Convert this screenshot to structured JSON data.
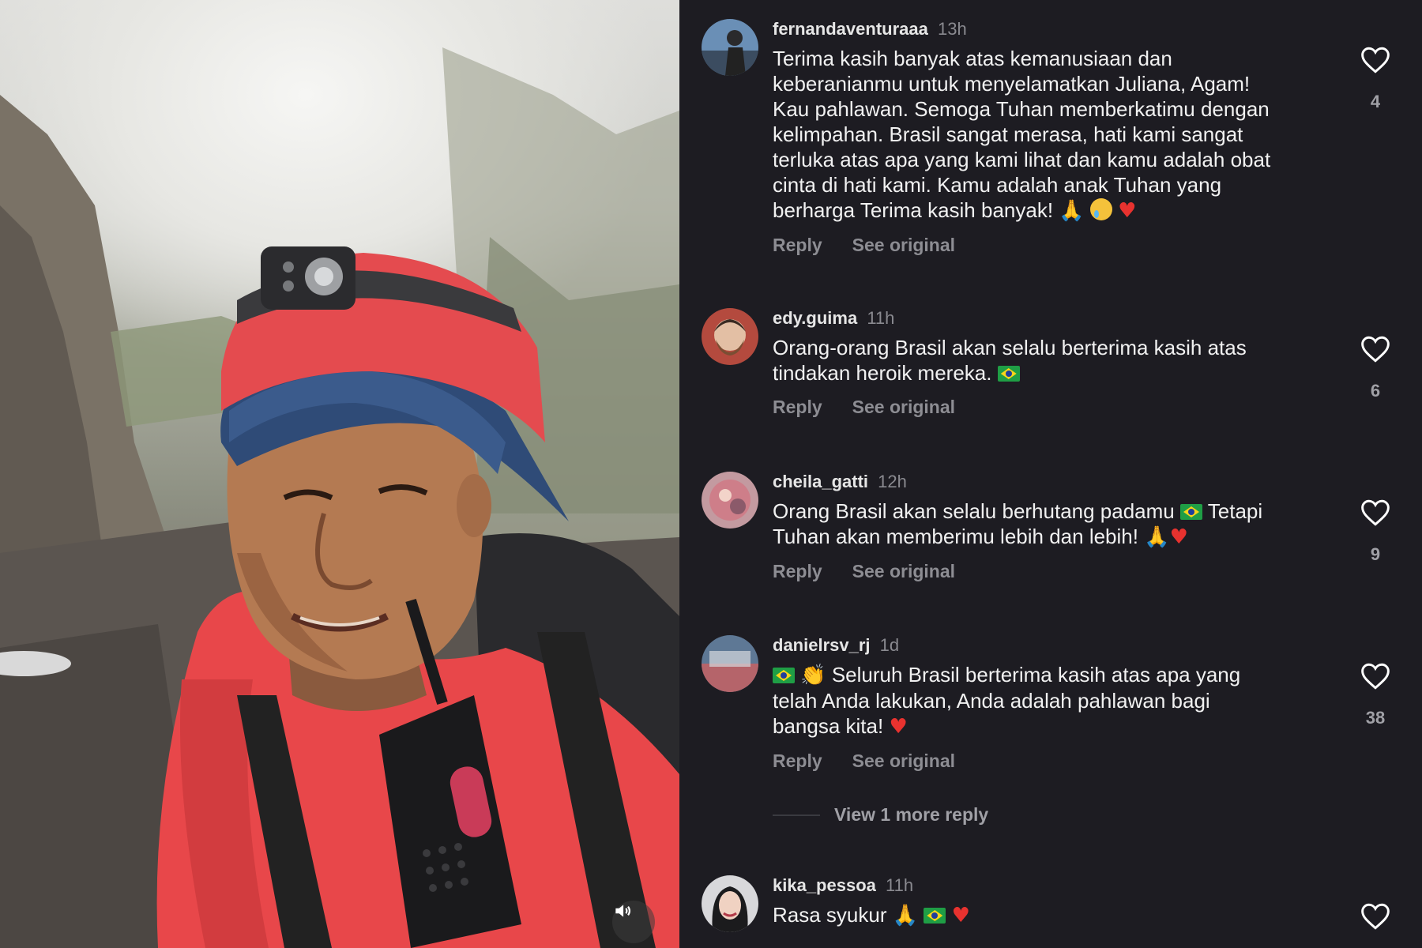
{
  "comments": [
    {
      "username": "fernandaventuraaa",
      "time": "13h",
      "text": "Terima kasih banyak atas kemanusiaan dan\nkeberanianmu untuk menyelamatkan Juliana, Agam!\nKau pahlawan. Semoga Tuhan memberkatimu dengan\nkelimpahan. Brasil sangat merasa, hati kami sangat\nterluka atas apa yang kami lihat dan kamu adalah obat\ncinta di hati kami. Kamu adalah anak Tuhan yang\nberharga Terima kasih banyak!",
      "likes": "4",
      "reply_label": "Reply",
      "see_original_label": "See original"
    },
    {
      "username": "edy.guima",
      "time": "11h",
      "text": "Orang-orang Brasil akan selalu berterima kasih atas\ntindakan heroik mereka.",
      "likes": "6",
      "reply_label": "Reply",
      "see_original_label": "See original"
    },
    {
      "username": "cheila_gatti",
      "time": "12h",
      "text_part1": "Orang Brasil akan selalu berhutang padamu",
      "text_part2": "Tetapi",
      "text_part3": "Tuhan akan memberimu lebih dan lebih!",
      "likes": "9",
      "reply_label": "Reply",
      "see_original_label": "See original"
    },
    {
      "username": "danielrsv_rj",
      "time": "1d",
      "text_part1": "Seluruh Brasil berterima kasih atas apa yang",
      "text_part2": "telah Anda lakukan, Anda adalah pahlawan bagi\nbangsa kita!",
      "likes": "38",
      "reply_label": "Reply",
      "see_original_label": "See original",
      "view_more_label": "View 1 more reply"
    },
    {
      "username": "kika_pessoa",
      "time": "11h",
      "text": "Rasa syukur"
    }
  ],
  "icons": {
    "like": "heart-outline-icon",
    "sound": "speaker-icon"
  },
  "colors": {
    "background": "#1d1c22",
    "heart": "#e8322f"
  }
}
